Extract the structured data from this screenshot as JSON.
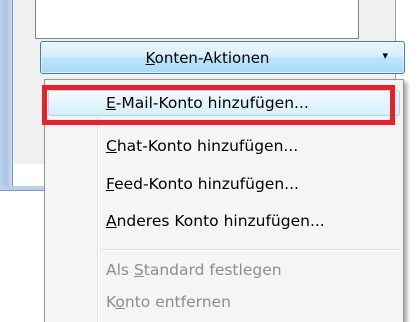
{
  "accounts_button": {
    "prefix": "",
    "mnemonic": "K",
    "rest": "onten-Aktionen",
    "arrow": "▾"
  },
  "menu": {
    "items": [
      {
        "prefix": "",
        "mnemonic": "E",
        "rest": "-Mail-Konto hinzufügen...",
        "enabled": true
      },
      {
        "prefix": "",
        "mnemonic": "C",
        "rest": "hat-Konto hinzufügen...",
        "enabled": true
      },
      {
        "prefix": "",
        "mnemonic": "F",
        "rest": "eed-Konto hinzufügen...",
        "enabled": true
      },
      {
        "prefix": "",
        "mnemonic": "A",
        "rest": "nderes Konto hinzufügen...",
        "enabled": true
      },
      {
        "prefix": "Als ",
        "mnemonic": "S",
        "rest": "tandard festlegen",
        "enabled": false
      },
      {
        "prefix": "K",
        "mnemonic": "o",
        "rest": "nto entfernen",
        "enabled": false
      }
    ]
  },
  "annotation": {
    "color": "#e8202a"
  }
}
